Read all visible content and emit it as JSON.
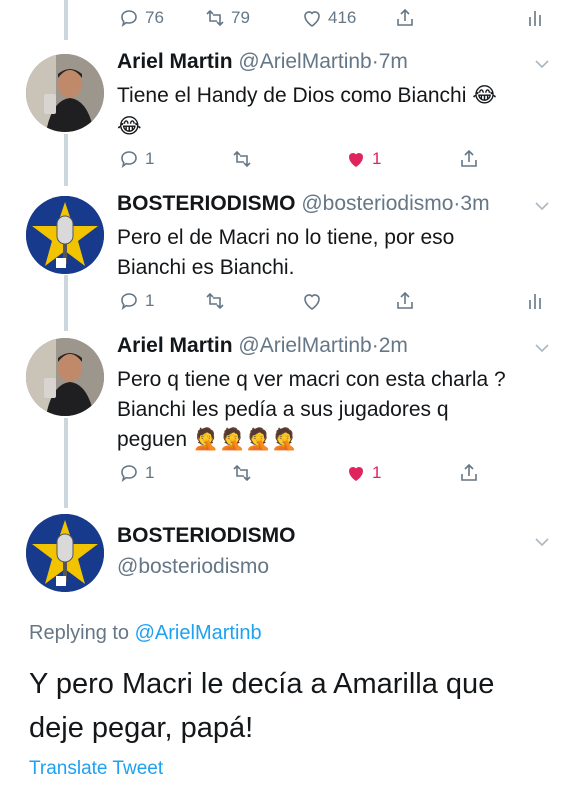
{
  "top_actions": {
    "replies": "76",
    "retweets": "79",
    "likes": "416"
  },
  "tweets": [
    {
      "name": "Ariel  Martin",
      "handle": "@ArielMartinb",
      "dot": "·",
      "time": "7m",
      "line1": "Tiene el Handy de Dios como Bianchi 😂",
      "line2": "😂",
      "replies": "1",
      "retweets": "",
      "likes": "1",
      "liked": true
    },
    {
      "name": "BOSTERIODISMO",
      "handle": "@bosteriodismo",
      "dot": "·",
      "time": "3m",
      "line1": "Pero el de Macri no lo tiene, por eso",
      "line2": "Bianchi es Bianchi.",
      "replies": "1",
      "retweets": "",
      "likes": "",
      "liked": false
    },
    {
      "name": "Ariel  Martin",
      "handle": "@ArielMartinb",
      "dot": "·",
      "time": "2m",
      "line1": "Pero q tiene q ver macri con esta charla ?",
      "line2": "Bianchi les pedía a sus jugadores q",
      "line3": "peguen 🤦🤦🤦🤦",
      "replies": "1",
      "retweets": "",
      "likes": "1",
      "liked": true
    }
  ],
  "main_tweet": {
    "name": "BOSTERIODISMO",
    "handle": "@bosteriodismo",
    "replying_prefix": "Replying to",
    "replying_mention": "@ArielMartinb",
    "text_line1": "Y pero Macri le decía a Amarilla que",
    "text_line2": "deje pegar, papá!",
    "translate": "Translate Tweet"
  },
  "colors": {
    "accent": "#1da1f2",
    "like": "#e0245e",
    "muted": "#657786",
    "thread": "#ccd6dd"
  }
}
